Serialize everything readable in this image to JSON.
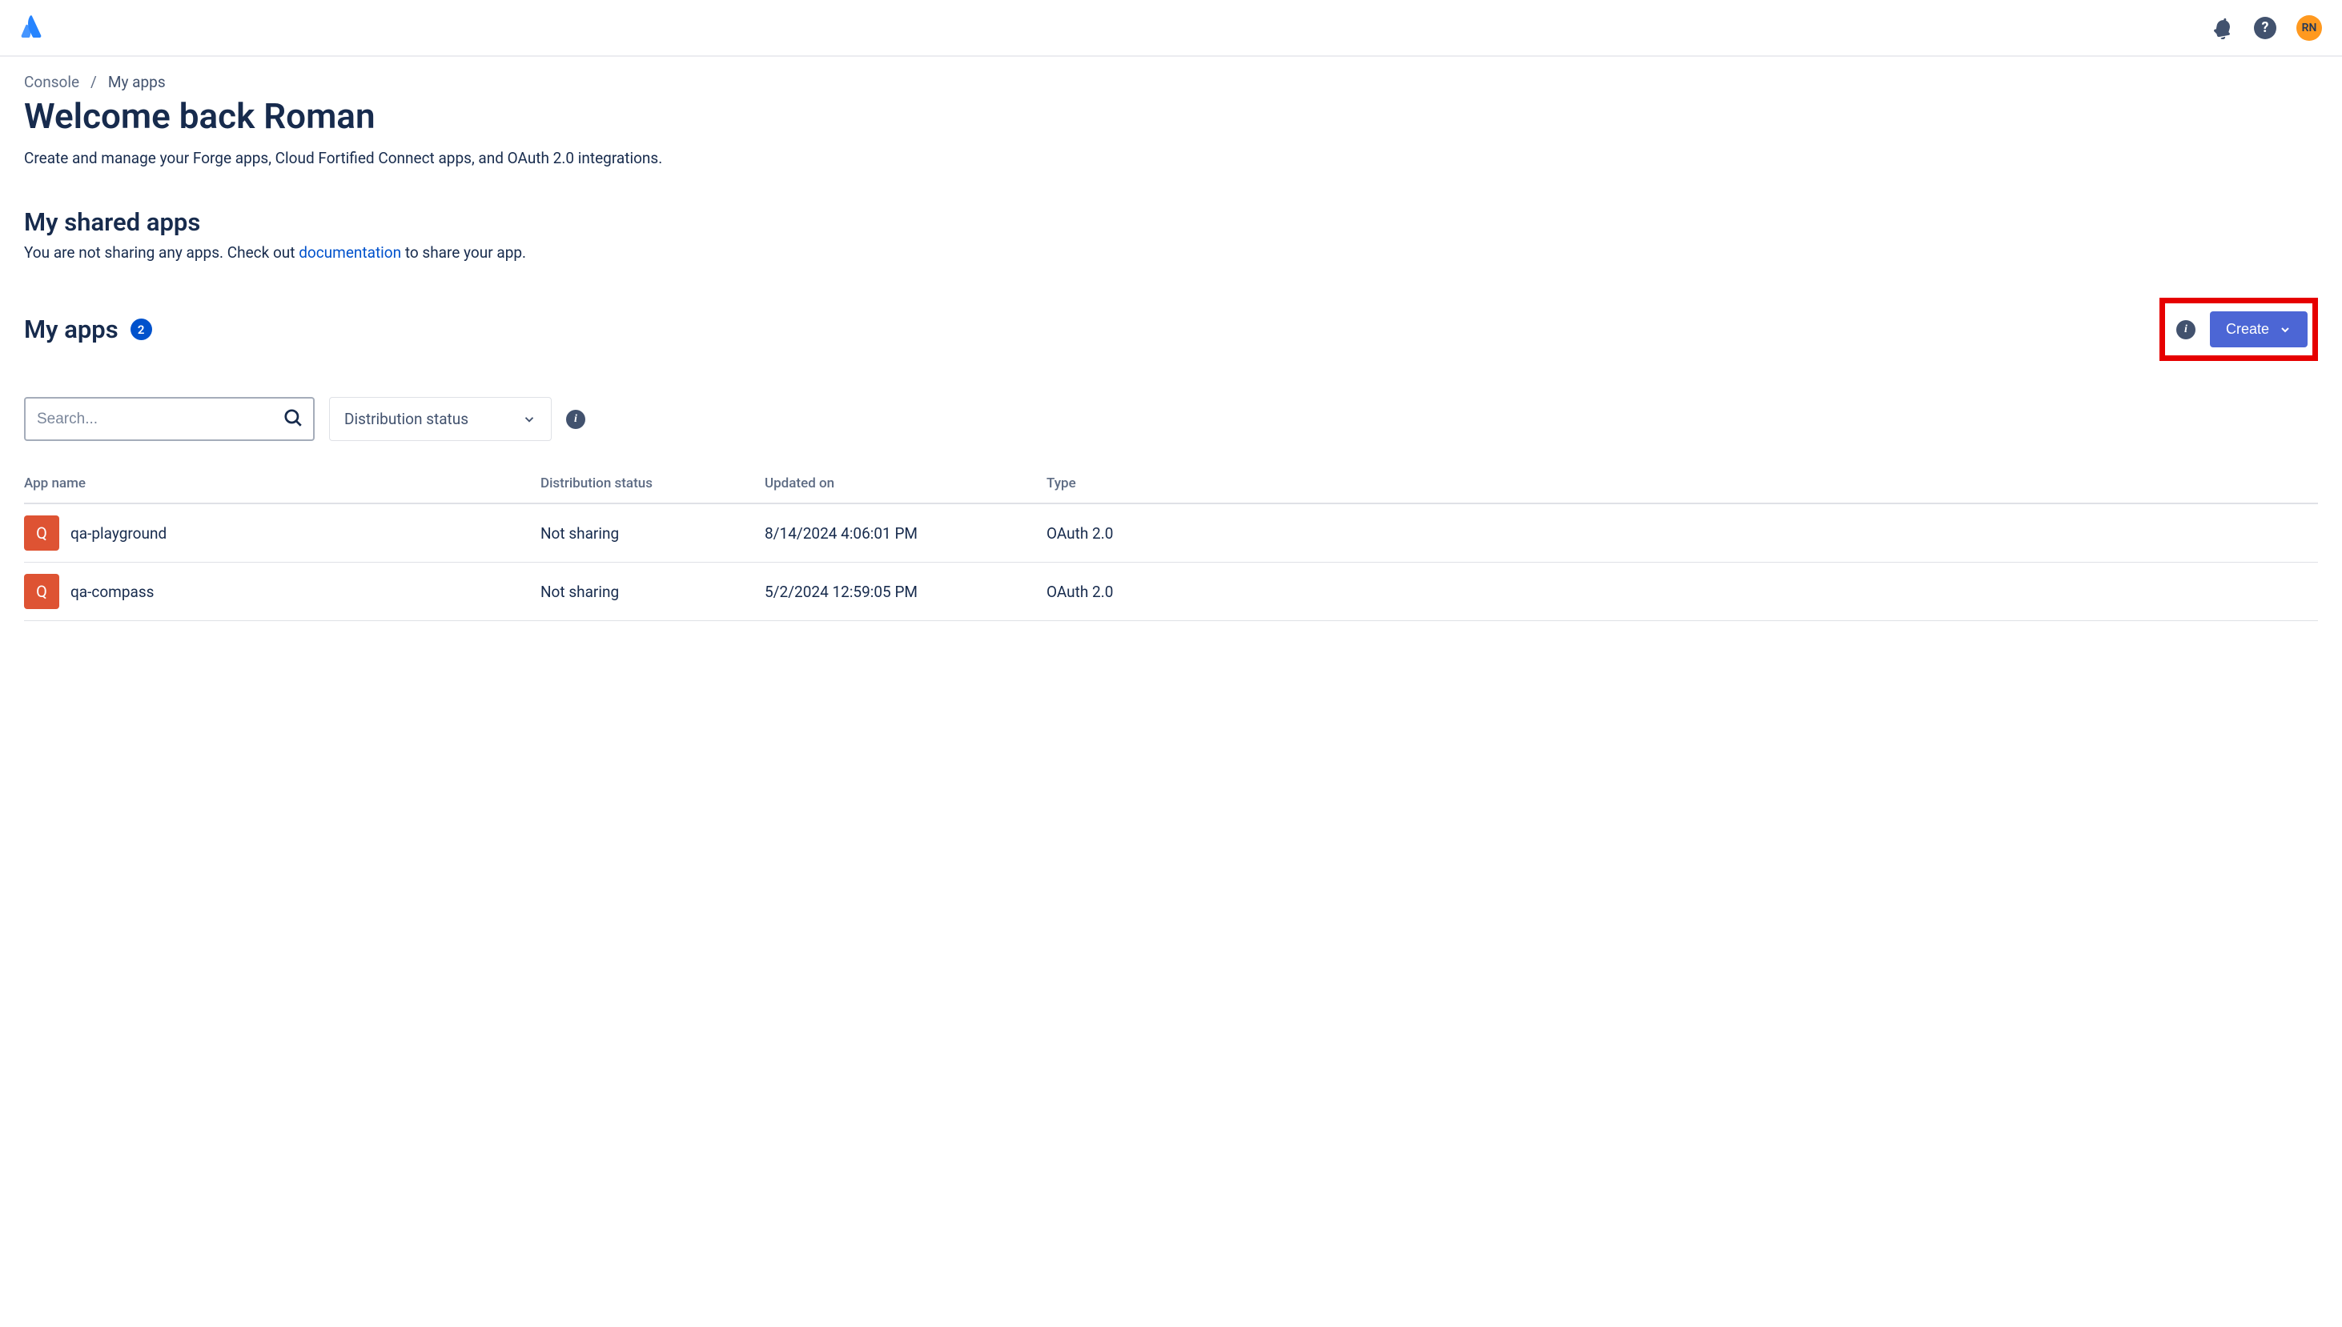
{
  "header": {
    "avatar_initials": "RN"
  },
  "breadcrumb": {
    "console": "Console",
    "myapps": "My apps",
    "sep": "/"
  },
  "page": {
    "title": "Welcome back Roman",
    "subtitle": "Create and manage your Forge apps, Cloud Fortified Connect apps, and OAuth 2.0 integrations."
  },
  "shared": {
    "title": "My shared apps",
    "desc_before": "You are not sharing any apps. Check out ",
    "desc_link": "documentation",
    "desc_after": " to share your app."
  },
  "myapps": {
    "title": "My apps",
    "count": "2",
    "create_label": "Create"
  },
  "filters": {
    "search_placeholder": "Search...",
    "dropdown_label": "Distribution status"
  },
  "table": {
    "headers": {
      "name": "App name",
      "dist": "Distribution status",
      "updated": "Updated on",
      "type": "Type"
    },
    "rows": [
      {
        "initial": "Q",
        "name": "qa-playground",
        "dist": "Not sharing",
        "updated": "8/14/2024 4:06:01 PM",
        "type": "OAuth 2.0"
      },
      {
        "initial": "Q",
        "name": "qa-compass",
        "dist": "Not sharing",
        "updated": "5/2/2024 12:59:05 PM",
        "type": "OAuth 2.0"
      }
    ]
  }
}
